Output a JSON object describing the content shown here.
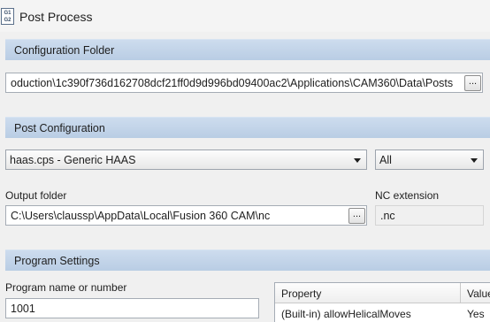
{
  "window": {
    "title": "Post Process",
    "icon_lines": [
      "G1",
      "G2"
    ]
  },
  "config_folder": {
    "header": "Configuration Folder",
    "path": "oduction\\1c390f736d162708dcf21ff0d9d996bd09400ac2\\Applications\\CAM360\\Data\\Posts",
    "browse_label": "..."
  },
  "post_config": {
    "header": "Post Configuration",
    "post_selected": "haas.cps - Generic HAAS",
    "filter_selected": "All",
    "output_folder_label": "Output folder",
    "output_folder_value": "C:\\Users\\claussp\\AppData\\Local\\Fusion 360 CAM\\nc",
    "output_browse_label": "...",
    "nc_extension_label": "NC extension",
    "nc_extension_value": ".nc"
  },
  "program_settings": {
    "header": "Program Settings",
    "program_name_label": "Program name or number",
    "program_name_value": "1001",
    "property_table": {
      "columns": [
        "Property",
        "Value"
      ],
      "rows": [
        {
          "property": "(Built-in) allowHelicalMoves",
          "value": "Yes"
        }
      ]
    }
  },
  "icons": {
    "window_icon": "gcode-file-icon",
    "dropdown_caret": "chevron-down-icon"
  }
}
